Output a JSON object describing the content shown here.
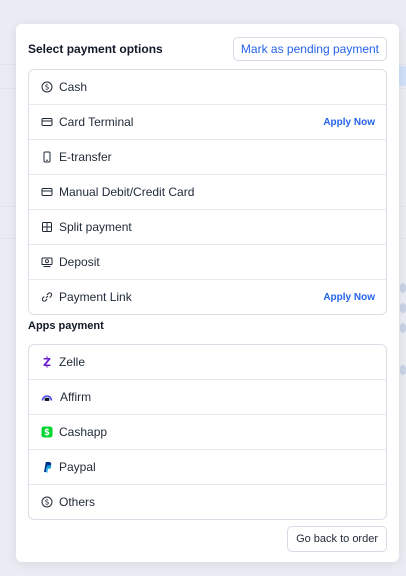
{
  "modal": {
    "title": "Select payment options",
    "pending_button": "Mark as pending payment",
    "back_button": "Go back to order"
  },
  "payment_options": [
    {
      "label": "Cash",
      "icon": "dollar-circle-icon"
    },
    {
      "label": "Card Terminal",
      "icon": "card-icon",
      "action": "Apply Now"
    },
    {
      "label": "E-transfer",
      "icon": "phone-icon"
    },
    {
      "label": "Manual Debit/Credit Card",
      "icon": "card-icon"
    },
    {
      "label": "Split payment",
      "icon": "split-grid-icon"
    },
    {
      "label": "Deposit",
      "icon": "deposit-icon"
    },
    {
      "label": "Payment Link",
      "icon": "link-icon",
      "action": "Apply Now"
    }
  ],
  "apps_section": {
    "title": "Apps payment",
    "items": [
      {
        "label": "Zelle",
        "icon": "zelle-icon"
      },
      {
        "label": "Affirm",
        "icon": "affirm-icon"
      },
      {
        "label": "Cashapp",
        "icon": "cashapp-icon"
      },
      {
        "label": "Paypal",
        "icon": "paypal-icon"
      },
      {
        "label": "Others",
        "icon": "dollar-circle-icon"
      }
    ]
  },
  "colors": {
    "accent": "#2563eb",
    "zelle": "#6d1ed4",
    "affirm": "#4a4af4",
    "cashapp": "#00d632",
    "paypal": "#003087"
  }
}
